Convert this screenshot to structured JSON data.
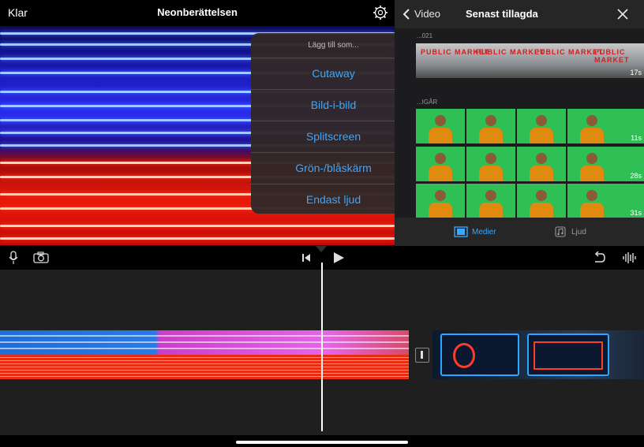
{
  "topbar": {
    "done_label": "Klar",
    "title": "Neonberättelsen"
  },
  "popover": {
    "title": "Lägg till som...",
    "items": [
      "Cutaway",
      "Bild-i-bild",
      "Splitscreen",
      "Grön-/blåskärm",
      "Endast ljud"
    ]
  },
  "browser": {
    "back_label": "Video",
    "title": "Senast tillagda",
    "sections": [
      {
        "label": "...021",
        "clips": [
          {
            "text": "PUBLIC MARKET",
            "duration": "17s"
          }
        ]
      },
      {
        "label": "...IGÅR",
        "clips": [
          {
            "duration": "11s"
          },
          {
            "duration": "28s"
          },
          {
            "duration": "31s"
          }
        ]
      }
    ],
    "tabs": [
      {
        "label": "Medier",
        "icon": "film-icon",
        "active": true
      },
      {
        "label": "Ljud",
        "icon": "music-note-icon",
        "active": false
      }
    ]
  },
  "colors": {
    "accent": "#3aa8ff",
    "background": "#000000",
    "panel": "#1c1c1e"
  }
}
